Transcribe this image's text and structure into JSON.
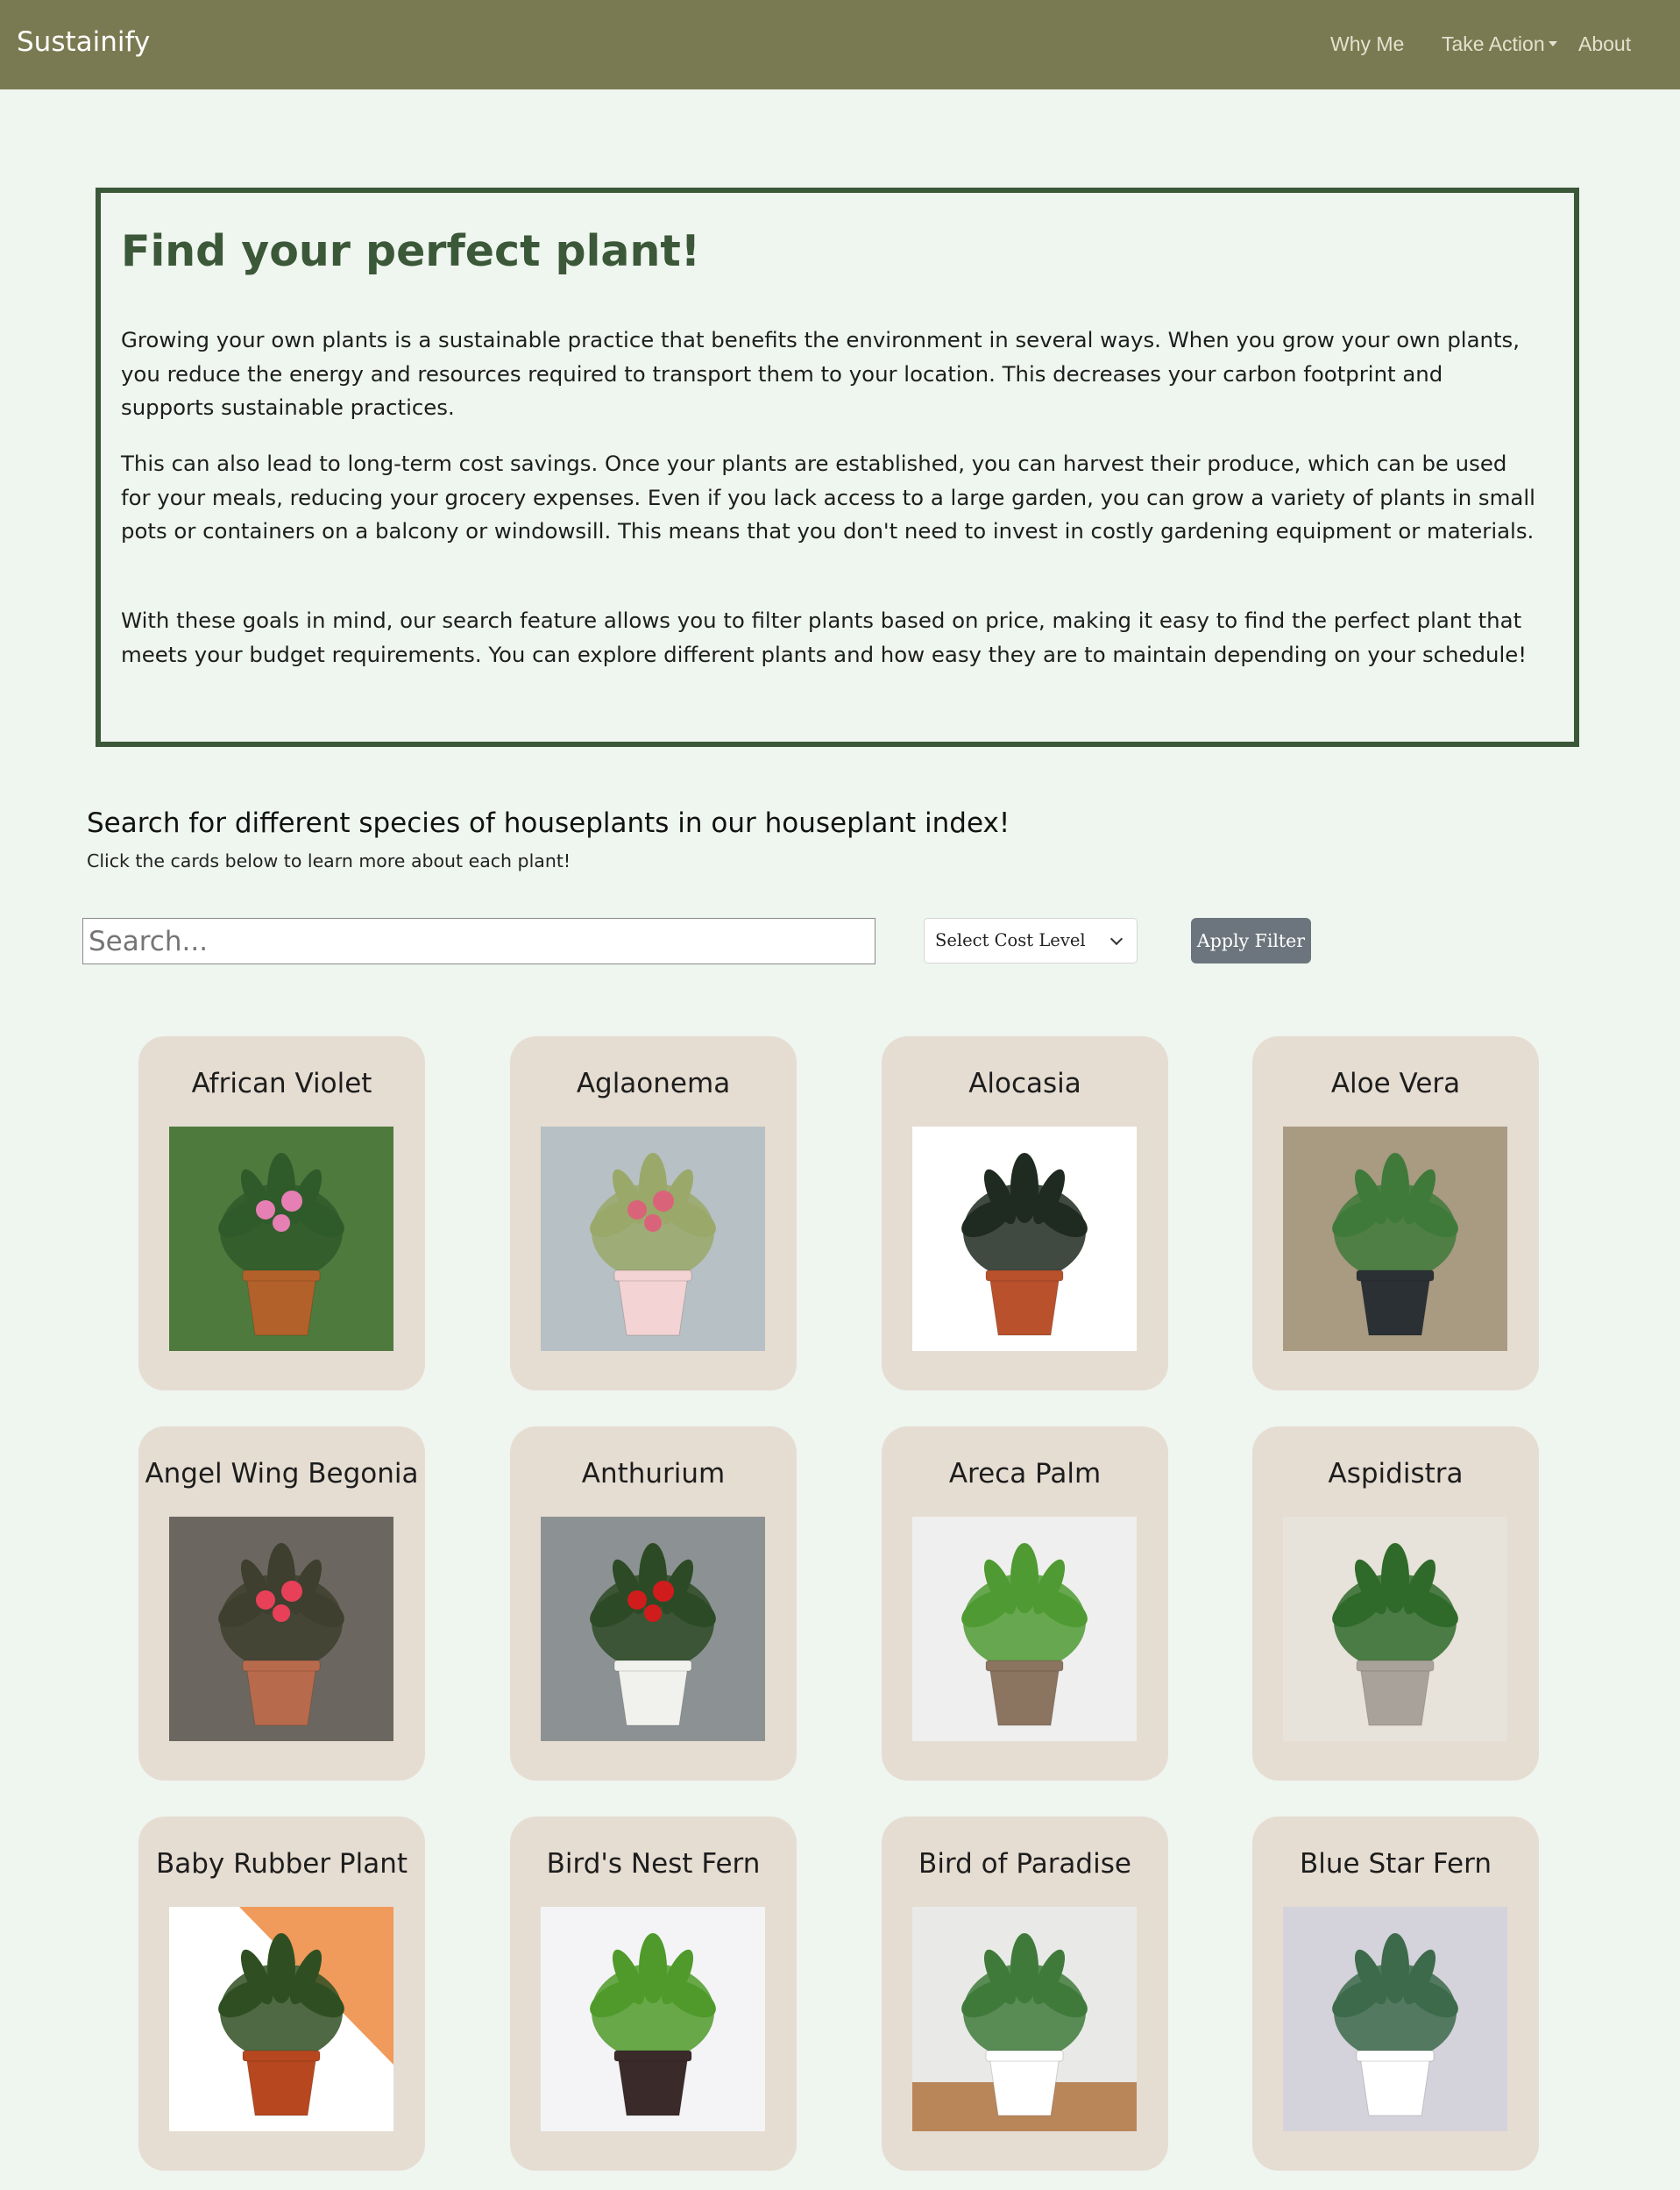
{
  "navbar": {
    "brand": "Sustainify",
    "links": [
      {
        "label": "Why Me"
      },
      {
        "label": "Take Action"
      },
      {
        "label": "About"
      }
    ]
  },
  "intro": {
    "title": "Find your perfect plant!",
    "paragraphs": [
      "Growing your own plants is a sustainable practice that benefits the environment in several ways. When you grow your own plants, you reduce the energy and resources required to transport them to your location. This decreases your carbon footprint and supports sustainable practices.",
      "This can also lead to long-term cost savings. Once your plants are established, you can harvest their produce, which can be used for your meals, reducing your grocery expenses. Even if you lack access to a large garden, you can grow a variety of plants in small pots or containers on a balcony or windowsill. This means that you don't need to invest in costly gardening equipment or materials.",
      "With these goals in mind, our search feature allows you to filter plants based on price, making it easy to find the perfect plant that meets your budget requirements. You can explore different plants and how easy they are to maintain depending on your schedule!"
    ]
  },
  "search": {
    "heading": "Search for different species of houseplants in our houseplant index!",
    "subheading": "Click the cards below to learn more about each plant!",
    "placeholder": "Search...",
    "cost_select": "Select Cost Level",
    "apply_label": "Apply Filter"
  },
  "plants": [
    {
      "name": "African Violet",
      "bg": "#4f7a3e",
      "pot": "#b3612a",
      "foliage": "#2f5a2a",
      "flower": "#e67fb4"
    },
    {
      "name": "Aglaonema",
      "bg": "#b7c0c4",
      "pot": "#f3d3d3",
      "foliage": "#9aa86a",
      "flower": "#d9647a"
    },
    {
      "name": "Alocasia",
      "bg": "#ffffff",
      "pot": "#b8512c",
      "foliage": "#1f2a20",
      "flower": ""
    },
    {
      "name": "Aloe Vera",
      "bg": "#a99a82",
      "pot": "#2b3034",
      "foliage": "#3f7a3a",
      "flower": ""
    },
    {
      "name": "Angel Wing Begonia",
      "bg": "#6b6760",
      "pot": "#b86a4c",
      "foliage": "#3e3f2e",
      "flower": "#e84058"
    },
    {
      "name": "Anthurium",
      "bg": "#8c9293",
      "pot": "#f1f1ee",
      "foliage": "#2d4a26",
      "flower": "#d01c1c"
    },
    {
      "name": "Areca Palm",
      "bg": "#efefef",
      "pot": "#8b7460",
      "foliage": "#4f9a32",
      "flower": ""
    },
    {
      "name": "Aspidistra",
      "bg": "#e7e2da",
      "pot": "#a8a29a",
      "foliage": "#2f6a2a",
      "flower": ""
    },
    {
      "name": "Baby Rubber Plant",
      "bg": "#ffffff",
      "pot": "#b7471f",
      "foliage": "#2f4f22",
      "flower": "",
      "accent": "#f09a5c"
    },
    {
      "name": "Bird's Nest Fern",
      "bg": "#f4f4f6",
      "pot": "#3a2a2a",
      "foliage": "#4f9a2a",
      "flower": ""
    },
    {
      "name": "Bird of Paradise",
      "bg": "#e9e9e7",
      "pot": "#ffffff",
      "foliage": "#3f7a3a",
      "flower": "",
      "floor": "#b9865a"
    },
    {
      "name": "Blue Star Fern",
      "bg": "#d4d2da",
      "pot": "#ffffff",
      "foliage": "#3c6a4a",
      "flower": ""
    }
  ]
}
